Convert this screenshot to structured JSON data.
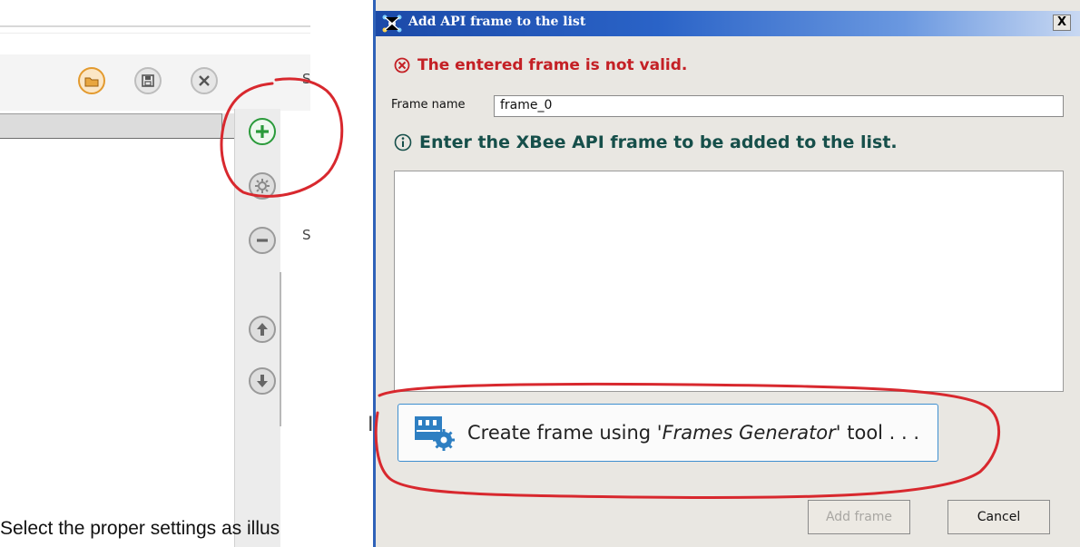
{
  "dialog": {
    "title": "Add API frame to the list",
    "close_label": "X",
    "error_message": "The entered frame is not valid.",
    "frame_name_label": "Frame name",
    "frame_name_value": "frame_0",
    "info_message": "Enter the XBee API frame to be added to the list.",
    "frame_content": "",
    "create_button": {
      "prefix": "Create frame using '",
      "tool_name": "Frames Generator",
      "suffix": "' tool . . ."
    },
    "add_frame_label": "Add frame",
    "cancel_label": "Cancel"
  },
  "left_panel": {
    "cut_glyphs": [
      "S",
      "S"
    ],
    "stray_glyph": "I"
  },
  "caption": {
    "text": "Select the proper settings as illus"
  },
  "colors": {
    "error": "#c42025",
    "info": "#164f4a",
    "titlebar": "#2a63c7",
    "annotation": "#d8282e",
    "add_icon": "#2a9a3a"
  },
  "icons": {
    "toolbar": [
      "open-folder-icon",
      "save-icon",
      "close-circle-icon"
    ],
    "sidebar": [
      "add-icon",
      "settings-gear-icon",
      "remove-icon",
      "move-up-icon",
      "move-down-icon"
    ]
  }
}
